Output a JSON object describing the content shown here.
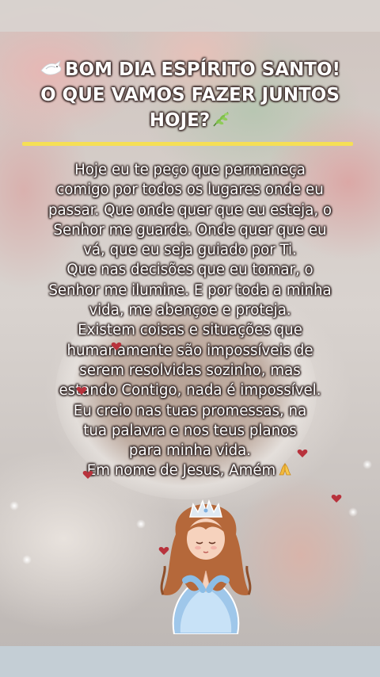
{
  "title": {
    "line1": "BOM DIA ESPÍRITO SANTO!",
    "line2": "O QUE VAMOS FAZER JUNTOS",
    "line3": "HOJE?",
    "lead_icon": "dove-icon",
    "trail_icon": "leaf-icon"
  },
  "prayer_lines": [
    "Hoje eu te peço que permaneça",
    "comigo por todos os lugares onde eu",
    "passar. Que onde quer que eu esteja, o",
    "Senhor me guarde. Onde quer que eu",
    "vá, que eu seja guiado por Ti.",
    "Que nas decisões que eu tomar, o",
    "Senhor me ilumine. E por toda a minha",
    "vida, me abençoe e proteja.",
    "Existem coisas e situações que",
    "humanamente são impossíveis de",
    "serem resolvidas sozinho, mas",
    "estando Contigo, nada é impossível.",
    "Eu creio nas tuas promessas, na",
    "tua palavra e nos teus planos",
    "para minha vida.",
    "Em nome de Jesus, Amém"
  ],
  "closing_icon": "praying-hands-icon",
  "figure_icon": "praying-princess-illustration",
  "colors": {
    "accent_line": "#f5df55",
    "text": "#ffffff",
    "heart": "#b8323c"
  }
}
